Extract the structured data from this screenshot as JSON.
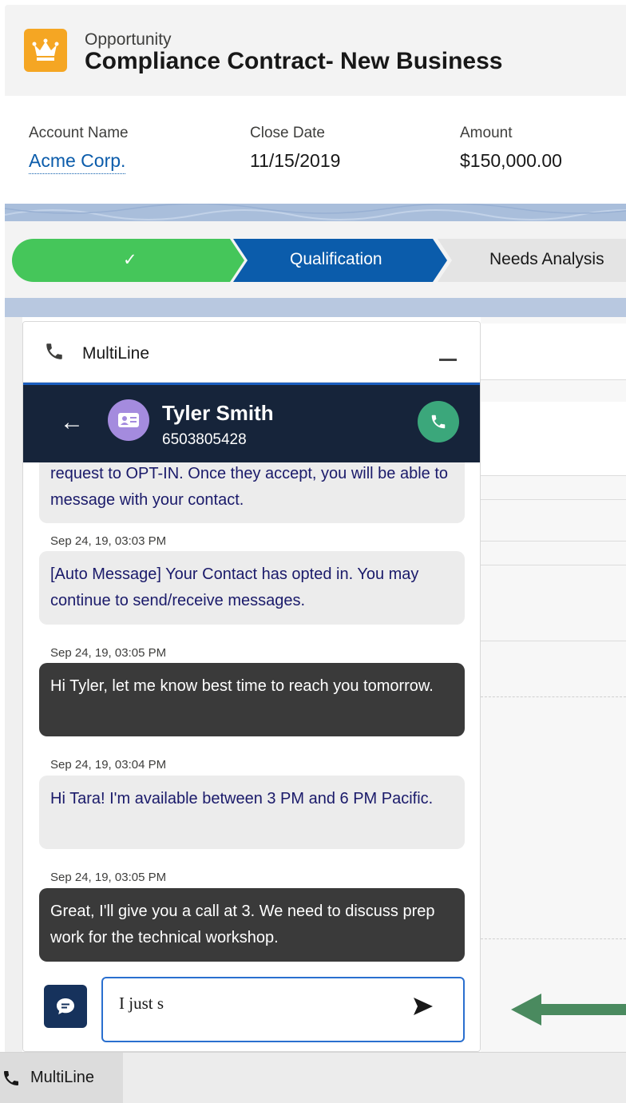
{
  "record": {
    "object_type": "Opportunity",
    "title": "Compliance Contract- New Business"
  },
  "fields": {
    "account_name_label": "Account Name",
    "account_name_value": "Acme Corp.",
    "close_date_label": "Close Date",
    "close_date_value": "11/15/2019",
    "amount_label": "Amount",
    "amount_value": "$150,000.00"
  },
  "path": {
    "completed_stage": "✓",
    "current_stage": "Qualification",
    "next_stage": "Needs Analysis"
  },
  "widget": {
    "title": "MultiLine",
    "contact_name": "Tyler Smith",
    "contact_phone": "6503805428",
    "messages": [
      {
        "direction": "in",
        "timestamp": "",
        "text": "request to OPT-IN. Once they accept, you will be able to message with your contact."
      },
      {
        "direction": "in",
        "timestamp": "Sep 24, 19, 03:03 PM",
        "text": "[Auto Message] Your Contact has opted in. You may continue to send/receive messages."
      },
      {
        "direction": "out",
        "timestamp": "Sep 24, 19, 03:05 PM",
        "text": "Hi Tyler, let me know best time to reach you tomorrow."
      },
      {
        "direction": "in",
        "timestamp": "Sep 24, 19, 03:04 PM",
        "text": "Hi Tara! I'm available between 3 PM and 6 PM Pacific."
      },
      {
        "direction": "out",
        "timestamp": "Sep 24, 19, 03:05 PM",
        "text": "Great, I'll give you a call at 3. We need to discuss prep work for the technical workshop."
      }
    ],
    "composer_value": "I just s"
  },
  "utility_bar": {
    "tab_label": "MultiLine"
  },
  "colors": {
    "brand_blue": "#0b5cab",
    "path_complete": "#45c65a",
    "path_current": "#0b5cab",
    "contact_bar": "#16243a",
    "call_green": "#3ba77b",
    "avatar_purple": "#a48bde",
    "opportunity_orange": "#f5a623",
    "hint_arrow": "#4a8a5f"
  }
}
